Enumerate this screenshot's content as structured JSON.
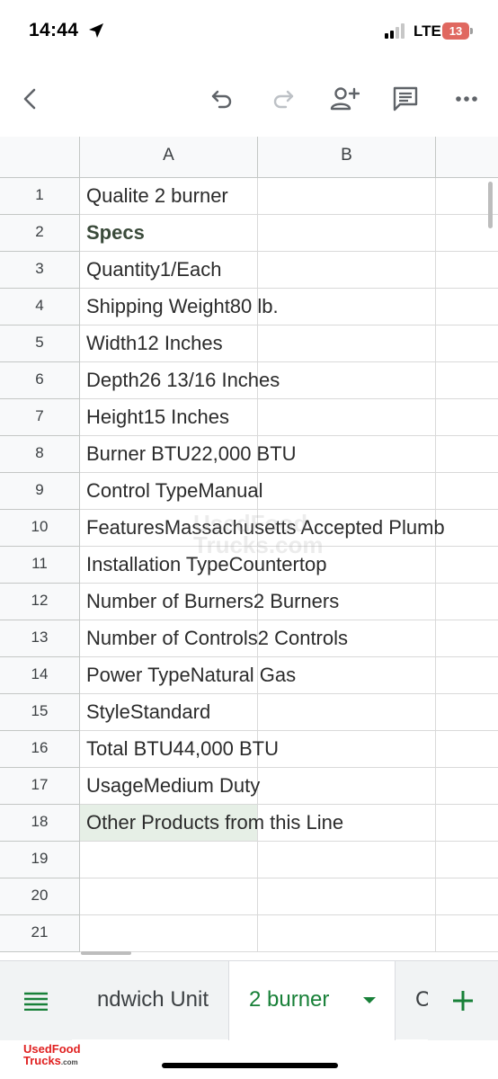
{
  "status_bar": {
    "time": "14:44",
    "network": "LTE",
    "battery": "13"
  },
  "toolbar": {
    "icons": [
      "back-icon",
      "undo-icon",
      "redo-icon",
      "add-person-icon",
      "comment-icon",
      "more-icon"
    ]
  },
  "grid": {
    "columns": [
      "A",
      "B"
    ],
    "rows": [
      {
        "num": "1",
        "text": "Qualite 2 burner",
        "spans": false
      },
      {
        "num": "2",
        "text": "Specs",
        "bold": true,
        "spans": false
      },
      {
        "num": "3",
        "text": "Quantity1/Each",
        "spans": false
      },
      {
        "num": "4",
        "text": "Shipping Weight80 lb.",
        "spans": true
      },
      {
        "num": "5",
        "text": "Width12 Inches",
        "spans": false
      },
      {
        "num": "6",
        "text": "Depth26 13/16 Inches",
        "spans": true
      },
      {
        "num": "7",
        "text": "Height15 Inches",
        "spans": false
      },
      {
        "num": "8",
        "text": "Burner BTU22,000 BTU",
        "spans": true
      },
      {
        "num": "9",
        "text": "Control TypeManual",
        "spans": true
      },
      {
        "num": "10",
        "text": "FeaturesMassachusetts Accepted Plumb",
        "spans": true,
        "wide": true
      },
      {
        "num": "11",
        "text": "Installation TypeCountertop",
        "spans": true
      },
      {
        "num": "12",
        "text": "Number of Burners2 Burners",
        "spans": true
      },
      {
        "num": "13",
        "text": "Number of Controls2 Controls",
        "spans": true
      },
      {
        "num": "14",
        "text": "Power TypeNatural Gas",
        "spans": true
      },
      {
        "num": "15",
        "text": "StyleStandard",
        "spans": false
      },
      {
        "num": "16",
        "text": "Total BTU44,000 BTU",
        "spans": true
      },
      {
        "num": "17",
        "text": "UsageMedium Duty",
        "spans": true
      },
      {
        "num": "18",
        "text": "Other Products from this Line",
        "spans": true,
        "selected": true
      },
      {
        "num": "19",
        "text": ""
      },
      {
        "num": "20",
        "text": ""
      },
      {
        "num": "21",
        "text": ""
      }
    ],
    "watermark": "UsedFood Trucks.com"
  },
  "sheets": {
    "tabs": [
      {
        "label": "ndwich Unit"
      },
      {
        "label": "2 burner",
        "active": true
      },
      {
        "label": "C"
      }
    ]
  },
  "footer": {
    "logo_line1": "UsedFood",
    "logo_line2": "Trucks",
    "logo_suffix": ".com"
  },
  "colors": {
    "accent": "#188038",
    "battery": "#e06860",
    "logo": "#e02020"
  }
}
